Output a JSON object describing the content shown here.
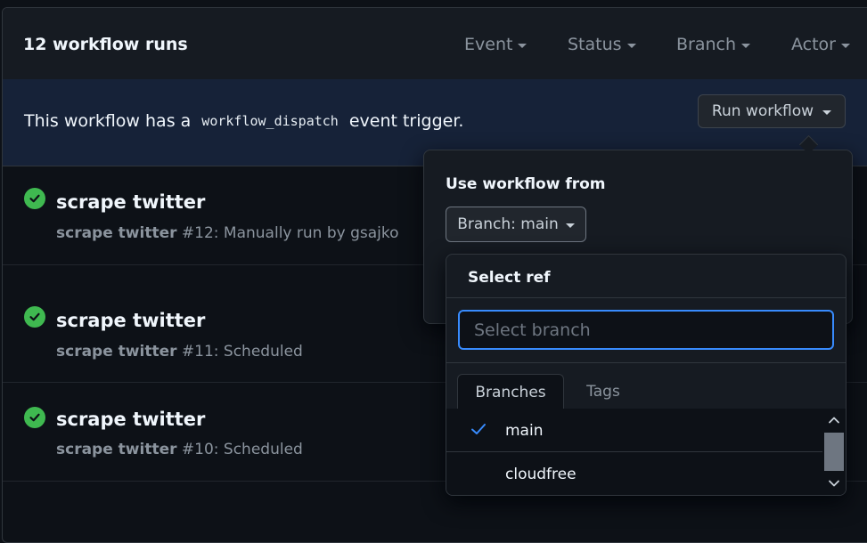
{
  "header": {
    "runs_count": "12 workflow runs",
    "filters": [
      "Event",
      "Status",
      "Branch",
      "Actor"
    ]
  },
  "banner": {
    "text_before": "This workflow has a",
    "code": "workflow_dispatch",
    "text_after": "event trigger.",
    "run_workflow_label": "Run workflow"
  },
  "runs": [
    {
      "title": "scrape twitter",
      "name": "scrape twitter",
      "detail": "#12: Manually run by gsajko"
    },
    {
      "title": "scrape twitter",
      "name": "scrape twitter",
      "detail": "#11: Scheduled"
    },
    {
      "title": "scrape twitter",
      "name": "scrape twitter",
      "detail": "#10: Scheduled"
    }
  ],
  "popup": {
    "title": "Use workflow from",
    "branch_button": "Branch: main"
  },
  "select_ref": {
    "title": "Select ref",
    "input_placeholder": "Select branch",
    "input_value": "",
    "tabs": [
      "Branches",
      "Tags"
    ],
    "active_tab": "Branches",
    "branches": [
      {
        "name": "main",
        "selected": true
      },
      {
        "name": "cloudfree",
        "selected": false
      }
    ]
  },
  "colors": {
    "success": "#3fb950",
    "focus_border": "#388bfd",
    "banner_bg": "#162238"
  }
}
